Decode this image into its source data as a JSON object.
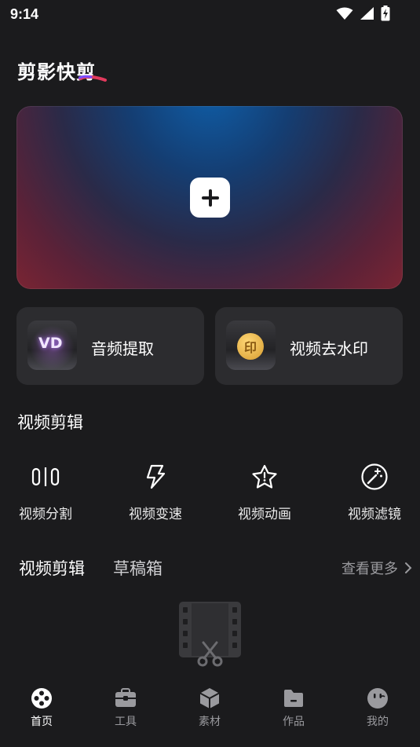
{
  "status": {
    "time": "9:14",
    "icons": [
      "wifi-icon",
      "signal-icon",
      "battery-charging-icon"
    ]
  },
  "app": {
    "title": "剪影快剪"
  },
  "hero": {
    "icon": "plus-icon"
  },
  "quick_actions": [
    {
      "label": "音频提取",
      "badge": "VD"
    },
    {
      "label": "视频去水印",
      "badge": "印"
    }
  ],
  "section": {
    "title": "视频剪辑"
  },
  "tools": [
    {
      "label": "视频分割",
      "icon": "split-icon"
    },
    {
      "label": "视频变速",
      "icon": "speed-icon"
    },
    {
      "label": "视频动画",
      "icon": "star-icon"
    },
    {
      "label": "视频滤镜",
      "icon": "filter-icon"
    }
  ],
  "tabs": {
    "primary": "视频剪辑",
    "secondary": "草稿箱",
    "more": "查看更多"
  },
  "nav": [
    {
      "label": "首页",
      "icon": "home-icon",
      "active": true
    },
    {
      "label": "工具",
      "icon": "toolbox-icon",
      "active": false
    },
    {
      "label": "素材",
      "icon": "cube-icon",
      "active": false
    },
    {
      "label": "作品",
      "icon": "folder-icon",
      "active": false
    },
    {
      "label": "我的",
      "icon": "profile-icon",
      "active": false
    }
  ],
  "colors": {
    "background": "#1b1b1d",
    "card": "#2c2c2f",
    "muted": "#9a9a9e",
    "gold": "#e4b24a"
  }
}
